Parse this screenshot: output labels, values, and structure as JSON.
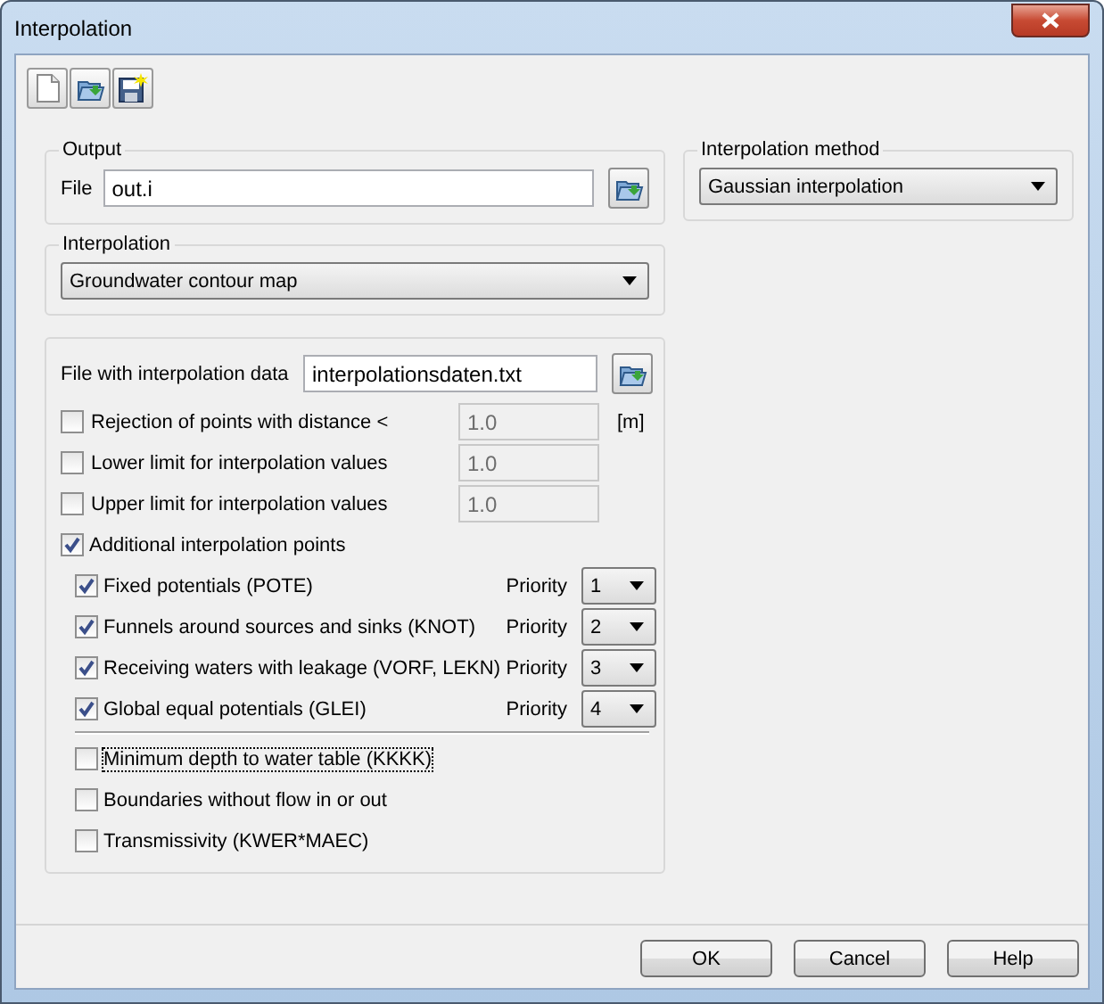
{
  "window": {
    "title": "Interpolation"
  },
  "toolbar": [
    {
      "kind": "new"
    },
    {
      "kind": "open"
    },
    {
      "kind": "save"
    }
  ],
  "output": {
    "title": "Output",
    "file_label": "File",
    "file_value": "out.i"
  },
  "interpolation": {
    "title": "Interpolation",
    "value": "Groundwater contour map"
  },
  "method": {
    "title": "Interpolation method",
    "value": "Gaussian interpolation"
  },
  "data": {
    "file_label": "File with interpolation data",
    "file_value": "interpolationsdaten.txt",
    "limits": [
      {
        "label": "Rejection of points with distance <",
        "checked": false,
        "value": "1.0",
        "disabled": true,
        "unit": "[m]"
      },
      {
        "label": "Lower limit for interpolation values",
        "checked": false,
        "value": "1.0",
        "disabled": true
      },
      {
        "label": "Upper limit for interpolation values",
        "checked": false,
        "value": "1.0",
        "disabled": true
      }
    ],
    "additional": {
      "label": "Additional interpolation points",
      "checked": true,
      "items": [
        {
          "label": "Fixed potentials (POTE)",
          "checked": true,
          "priority_label": "Priority",
          "priority": "1"
        },
        {
          "label": "Funnels around sources and sinks (KNOT)",
          "checked": true,
          "priority_label": "Priority",
          "priority": "2"
        },
        {
          "label": "Receiving waters with leakage (VORF, LEKN)",
          "checked": true,
          "priority_label": "Priority",
          "priority": "3"
        },
        {
          "label": "Global equal potentials (GLEI)",
          "checked": true,
          "priority_label": "Priority",
          "priority": "4"
        }
      ]
    },
    "extras": [
      {
        "label": "Minimum depth to water table (KKKK)",
        "checked": false,
        "focused": true
      },
      {
        "label": "Boundaries without flow in or out",
        "checked": false,
        "focused": false
      },
      {
        "label": "Transmissivity (KWER*MAEC)",
        "checked": false,
        "focused": false
      }
    ]
  },
  "buttons": [
    "OK",
    "Cancel",
    "Help"
  ]
}
